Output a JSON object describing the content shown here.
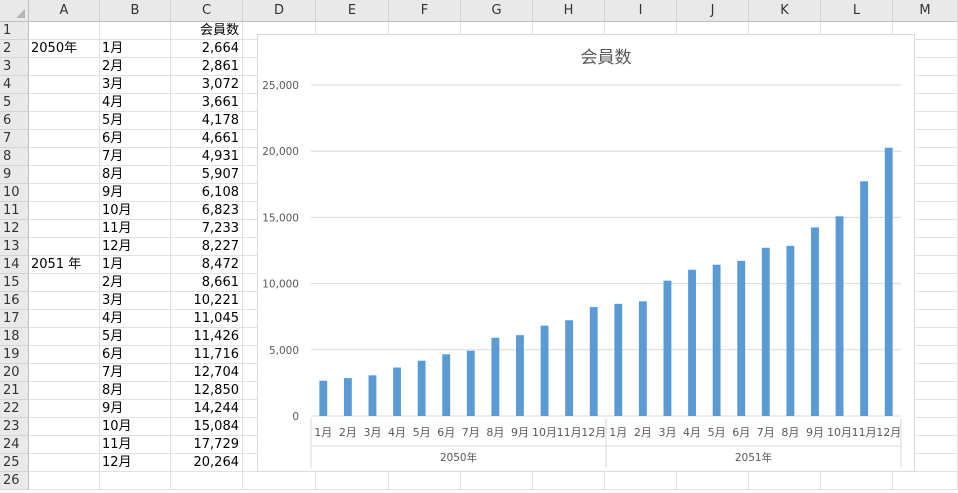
{
  "columns": [
    "A",
    "B",
    "C",
    "D",
    "E",
    "F",
    "G",
    "H",
    "I",
    "J",
    "K",
    "L",
    "M"
  ],
  "rows": [
    {
      "n": "1",
      "a": "",
      "b": "",
      "c": "会員数"
    },
    {
      "n": "2",
      "a": "2050年",
      "b": "1月",
      "c": "2,664"
    },
    {
      "n": "3",
      "a": "",
      "b": "2月",
      "c": "2,861"
    },
    {
      "n": "4",
      "a": "",
      "b": "3月",
      "c": "3,072"
    },
    {
      "n": "5",
      "a": "",
      "b": "4月",
      "c": "3,661"
    },
    {
      "n": "6",
      "a": "",
      "b": "5月",
      "c": "4,178"
    },
    {
      "n": "7",
      "a": "",
      "b": "6月",
      "c": "4,661"
    },
    {
      "n": "8",
      "a": "",
      "b": "7月",
      "c": "4,931"
    },
    {
      "n": "9",
      "a": "",
      "b": "8月",
      "c": "5,907"
    },
    {
      "n": "10",
      "a": "",
      "b": "9月",
      "c": "6,108"
    },
    {
      "n": "11",
      "a": "",
      "b": "10月",
      "c": "6,823"
    },
    {
      "n": "12",
      "a": "",
      "b": "11月",
      "c": "7,233"
    },
    {
      "n": "13",
      "a": "",
      "b": "12月",
      "c": "8,227"
    },
    {
      "n": "14",
      "a": "2051 年",
      "b": "1月",
      "c": "8,472"
    },
    {
      "n": "15",
      "a": "",
      "b": "2月",
      "c": "8,661"
    },
    {
      "n": "16",
      "a": "",
      "b": "3月",
      "c": "10,221"
    },
    {
      "n": "17",
      "a": "",
      "b": "4月",
      "c": "11,045"
    },
    {
      "n": "18",
      "a": "",
      "b": "5月",
      "c": "11,426"
    },
    {
      "n": "19",
      "a": "",
      "b": "6月",
      "c": "11,716"
    },
    {
      "n": "20",
      "a": "",
      "b": "7月",
      "c": "12,704"
    },
    {
      "n": "21",
      "a": "",
      "b": "8月",
      "c": "12,850"
    },
    {
      "n": "22",
      "a": "",
      "b": "9月",
      "c": "14,244"
    },
    {
      "n": "23",
      "a": "",
      "b": "10月",
      "c": "15,084"
    },
    {
      "n": "24",
      "a": "",
      "b": "11月",
      "c": "17,729"
    },
    {
      "n": "25",
      "a": "",
      "b": "12月",
      "c": "20,264"
    },
    {
      "n": "26",
      "a": "",
      "b": "",
      "c": ""
    }
  ],
  "chart_data": {
    "type": "bar",
    "title": "会員数",
    "categories": [
      "1月",
      "2月",
      "3月",
      "4月",
      "5月",
      "6月",
      "7月",
      "8月",
      "9月",
      "10月",
      "11月",
      "12月",
      "1月",
      "2月",
      "3月",
      "4月",
      "5月",
      "6月",
      "7月",
      "8月",
      "9月",
      "10月",
      "11月",
      "12月"
    ],
    "groups": [
      {
        "label": "2050年",
        "count": 12
      },
      {
        "label": "2051年",
        "count": 12
      }
    ],
    "series": [
      {
        "values": [
          2664,
          2861,
          3072,
          3661,
          4178,
          4661,
          4931,
          5907,
          6108,
          6823,
          7233,
          8227,
          8472,
          8661,
          10221,
          11045,
          11426,
          11716,
          12704,
          12850,
          14244,
          15084,
          17729,
          20264
        ]
      }
    ],
    "ylim": [
      0,
      25000
    ],
    "yticks": [
      "0",
      "5,000",
      "10,000",
      "15,000",
      "20,000",
      "25,000"
    ],
    "grid": true,
    "legend": "none",
    "bar_color": "#5b9bd5"
  }
}
